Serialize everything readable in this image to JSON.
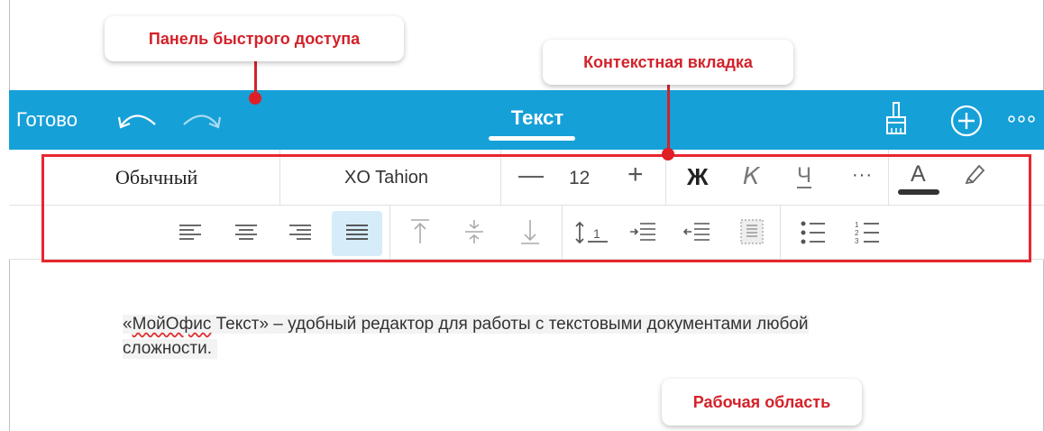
{
  "callouts": {
    "quick_access": "Панель быстрого доступа",
    "context_tab": "Контекстная вкладка",
    "work_area": "Рабочая область"
  },
  "appbar": {
    "done_label": "Готово",
    "tab_label": "Текст",
    "icons": [
      "undo-icon",
      "redo-icon",
      "paint-brush-icon",
      "plus-circle-icon",
      "more-icon"
    ],
    "background": "#16a0d8"
  },
  "toolbar": {
    "paragraph_style": "Обычный",
    "font_name": "XO Tahion",
    "size_minus": "—",
    "font_size": "12",
    "size_plus": "+",
    "bold": "Ж",
    "italic": "К",
    "underline": "Ч",
    "more": "···",
    "font_color": "A",
    "align_active": "justify",
    "accent": "#d6ecf9"
  },
  "document": {
    "line1_prefix": "«",
    "misspelled": "МойОфис",
    "line1_rest": " Текст» – удобный редактор для работы с текстовыми документами любой",
    "line2": "сложности."
  },
  "annotation_color": "#e8262f"
}
